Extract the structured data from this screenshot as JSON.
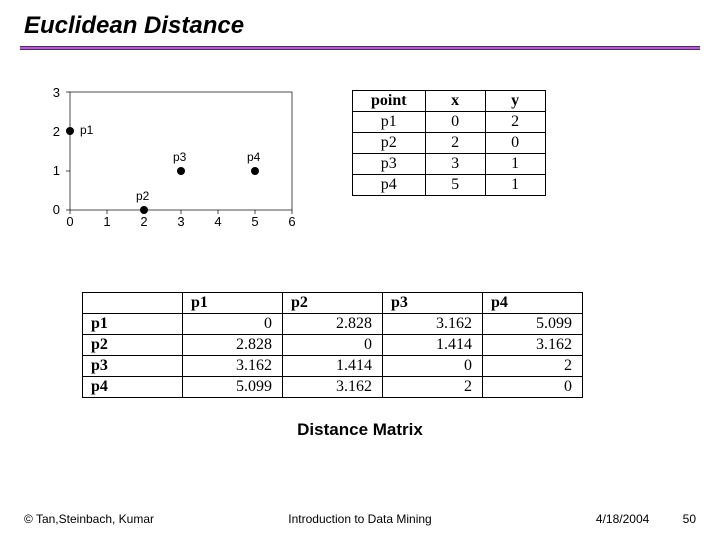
{
  "title": "Euclidean Distance",
  "subtitle": "Distance Matrix",
  "footer": {
    "left": "© Tan,Steinbach, Kumar",
    "center": "Introduction to Data Mining",
    "date": "4/18/2004",
    "page": "50"
  },
  "coord_table": {
    "headers": [
      "point",
      "x",
      "y"
    ],
    "rows": [
      [
        "p1",
        "0",
        "2"
      ],
      [
        "p2",
        "2",
        "0"
      ],
      [
        "p3",
        "3",
        "1"
      ],
      [
        "p4",
        "5",
        "1"
      ]
    ]
  },
  "dist_table": {
    "col_headers": [
      "",
      "p1",
      "p2",
      "p3",
      "p4"
    ],
    "rows": [
      [
        "p1",
        "0",
        "2.828",
        "3.162",
        "5.099"
      ],
      [
        "p2",
        "2.828",
        "0",
        "1.414",
        "3.162"
      ],
      [
        "p3",
        "3.162",
        "1.414",
        "0",
        "2"
      ],
      [
        "p4",
        "5.099",
        "3.162",
        "2",
        "0"
      ]
    ]
  },
  "chart_data": {
    "type": "scatter",
    "title": "",
    "xlabel": "",
    "ylabel": "",
    "xlim": [
      0,
      6
    ],
    "ylim": [
      0,
      3
    ],
    "xticks": [
      0,
      1,
      2,
      3,
      4,
      5,
      6
    ],
    "yticks": [
      0,
      1,
      2,
      3
    ],
    "series": [
      {
        "name": "points",
        "points": [
          {
            "label": "p1",
            "x": 0,
            "y": 2
          },
          {
            "label": "p2",
            "x": 2,
            "y": 0
          },
          {
            "label": "p3",
            "x": 3,
            "y": 1
          },
          {
            "label": "p4",
            "x": 5,
            "y": 1
          }
        ]
      }
    ]
  }
}
